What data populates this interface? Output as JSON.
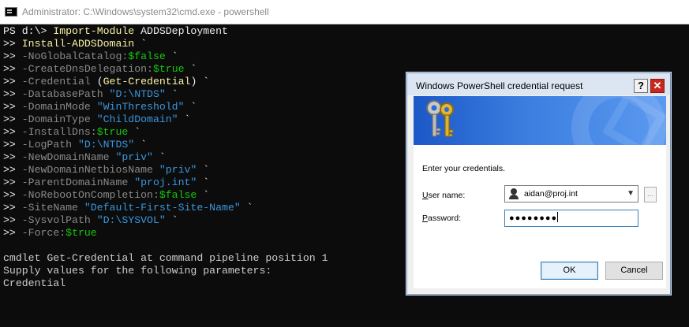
{
  "window": {
    "title": "Administrator: C:\\Windows\\system32\\cmd.exe - powershell"
  },
  "console": {
    "lines": [
      [
        {
          "t": "PS d:\\> ",
          "c": "w"
        },
        {
          "t": "Import-Module",
          "c": "y"
        },
        {
          "t": " ADDSDeployment",
          "c": "w"
        }
      ],
      [
        {
          "t": ">> ",
          "c": "w"
        },
        {
          "t": "Install-ADDSDomain",
          "c": "y"
        },
        {
          "t": " `",
          "c": "w"
        }
      ],
      [
        {
          "t": ">> ",
          "c": "w"
        },
        {
          "t": "-NoGlobalCatalog:",
          "c": "g"
        },
        {
          "t": "$false",
          "c": "grn"
        },
        {
          "t": " `",
          "c": "w"
        }
      ],
      [
        {
          "t": ">> ",
          "c": "w"
        },
        {
          "t": "-CreateDnsDelegation:",
          "c": "g"
        },
        {
          "t": "$true",
          "c": "grn"
        },
        {
          "t": " `",
          "c": "w"
        }
      ],
      [
        {
          "t": ">> ",
          "c": "w"
        },
        {
          "t": "-Credential ",
          "c": "g"
        },
        {
          "t": "(",
          "c": "w"
        },
        {
          "t": "Get-Credential",
          "c": "y"
        },
        {
          "t": ") `",
          "c": "w"
        }
      ],
      [
        {
          "t": ">> ",
          "c": "w"
        },
        {
          "t": "-DatabasePath ",
          "c": "g"
        },
        {
          "t": "\"D:\\NTDS\"",
          "c": "s"
        },
        {
          "t": " `",
          "c": "w"
        }
      ],
      [
        {
          "t": ">> ",
          "c": "w"
        },
        {
          "t": "-DomainMode ",
          "c": "g"
        },
        {
          "t": "\"WinThreshold\"",
          "c": "s"
        },
        {
          "t": " `",
          "c": "w"
        }
      ],
      [
        {
          "t": ">> ",
          "c": "w"
        },
        {
          "t": "-DomainType ",
          "c": "g"
        },
        {
          "t": "\"ChildDomain\"",
          "c": "s"
        },
        {
          "t": " `",
          "c": "w"
        }
      ],
      [
        {
          "t": ">> ",
          "c": "w"
        },
        {
          "t": "-InstallDns:",
          "c": "g"
        },
        {
          "t": "$true",
          "c": "grn"
        },
        {
          "t": " `",
          "c": "w"
        }
      ],
      [
        {
          "t": ">> ",
          "c": "w"
        },
        {
          "t": "-LogPath ",
          "c": "g"
        },
        {
          "t": "\"D:\\NTDS\"",
          "c": "s"
        },
        {
          "t": " `",
          "c": "w"
        }
      ],
      [
        {
          "t": ">> ",
          "c": "w"
        },
        {
          "t": "-NewDomainName ",
          "c": "g"
        },
        {
          "t": "\"priv\"",
          "c": "s"
        },
        {
          "t": " `",
          "c": "w"
        }
      ],
      [
        {
          "t": ">> ",
          "c": "w"
        },
        {
          "t": "-NewDomainNetbiosName ",
          "c": "g"
        },
        {
          "t": "\"priv\"",
          "c": "s"
        },
        {
          "t": " `",
          "c": "w"
        }
      ],
      [
        {
          "t": ">> ",
          "c": "w"
        },
        {
          "t": "-ParentDomainName ",
          "c": "g"
        },
        {
          "t": "\"proj.int\"",
          "c": "s"
        },
        {
          "t": " `",
          "c": "w"
        }
      ],
      [
        {
          "t": ">> ",
          "c": "w"
        },
        {
          "t": "-NoRebootOnCompletion:",
          "c": "g"
        },
        {
          "t": "$false",
          "c": "grn"
        },
        {
          "t": " `",
          "c": "w"
        }
      ],
      [
        {
          "t": ">> ",
          "c": "w"
        },
        {
          "t": "-SiteName ",
          "c": "g"
        },
        {
          "t": "\"Default-First-Site-Name\"",
          "c": "s"
        },
        {
          "t": " `",
          "c": "w"
        }
      ],
      [
        {
          "t": ">> ",
          "c": "w"
        },
        {
          "t": "-SysvolPath ",
          "c": "g"
        },
        {
          "t": "\"D:\\SYSVOL\"",
          "c": "s"
        },
        {
          "t": " `",
          "c": "w"
        }
      ],
      [
        {
          "t": ">> ",
          "c": "w"
        },
        {
          "t": "-Force:",
          "c": "g"
        },
        {
          "t": "$true",
          "c": "grn"
        }
      ],
      [],
      [
        {
          "t": "cmdlet Get-Credential at command pipeline position 1",
          "c": "c"
        }
      ],
      [
        {
          "t": "Supply values for the following parameters:",
          "c": "c"
        }
      ],
      [
        {
          "t": "Credential",
          "c": "c"
        }
      ]
    ]
  },
  "dialog": {
    "title": "Windows PowerShell credential request",
    "help_label": "?",
    "close_label": "✕",
    "prompt": "Enter your credentials.",
    "username_label_accel": "U",
    "username_label_rest": "ser name:",
    "username_value": "aidan@proj.int",
    "password_label_accel": "P",
    "password_label_rest": "assword:",
    "password_mask": "●●●●●●●●",
    "browse_label": "...",
    "ok_label": "OK",
    "cancel_label": "Cancel",
    "icon": "keys-icon"
  }
}
